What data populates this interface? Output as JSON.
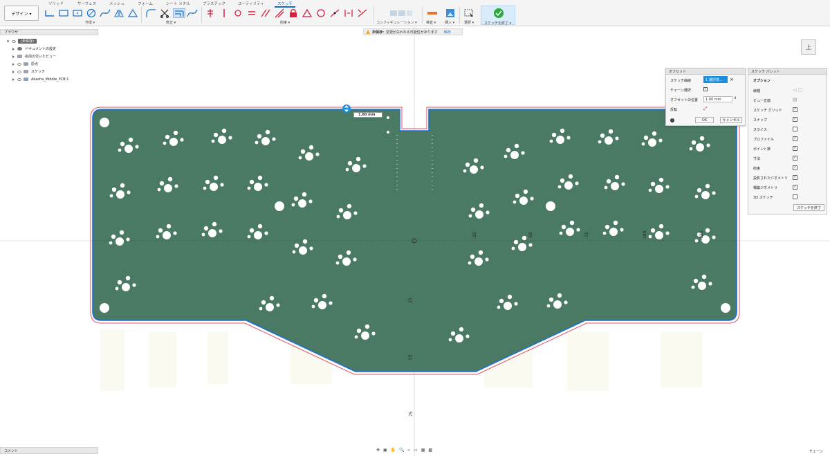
{
  "toolbar": {
    "design_label": "デザイン ▾",
    "tabs": [
      "ソリッド",
      "サーフェス",
      "メッシュ",
      "フォーム",
      "シート メタル",
      "プラスチック",
      "ユーティリティ",
      "スケッチ"
    ],
    "groups": {
      "create": "作成 ▾",
      "modify": "修正 ▾",
      "constraints": "拘束 ▾",
      "configuration": "コンフィギュレーション ▾",
      "inspect": "検査 ▾",
      "insert": "挿入 ▾",
      "select": "選択 ▾",
      "finish": "スケッチを終了 ▾"
    }
  },
  "browser": {
    "title": "ブラウザ",
    "items": [
      {
        "label": "(未保存)"
      },
      {
        "label": "ドキュメントの設定"
      },
      {
        "label": "名前の付いたビュー"
      },
      {
        "label": "原点"
      },
      {
        "label": "スケッチ"
      },
      {
        "label": "Akasha_Middle_PCB:1"
      }
    ]
  },
  "warning": {
    "prefix": "未保存:",
    "message": "変更が失われる可能性があります",
    "save": "保存"
  },
  "offset_dialog": {
    "title": "オフセット",
    "sketch_curve_label": "スケッチ曲線",
    "sketch_curve_value": "1 選択済...",
    "chain_select_label": "チェーン選択",
    "offset_position_label": "オフセットの位置",
    "offset_position_value": "1.00 mm",
    "flip_label": "反転",
    "ok": "OK",
    "cancel": "キャンセル"
  },
  "sketch_palette": {
    "title": "スケッチ パレット",
    "section": "オプション",
    "options": [
      {
        "label": "線種",
        "checked": null
      },
      {
        "label": "ビュー正面",
        "checked": null
      },
      {
        "label": "スケッチ グリッド",
        "checked": true
      },
      {
        "label": "スナップ",
        "checked": true
      },
      {
        "label": "スライス",
        "checked": false
      },
      {
        "label": "プロファイル",
        "checked": true
      },
      {
        "label": "ポイント数",
        "checked": true
      },
      {
        "label": "寸法",
        "checked": true
      },
      {
        "label": "拘束",
        "checked": true
      },
      {
        "label": "投影されたジオメトリ",
        "checked": true
      },
      {
        "label": "構築ジオメトリ",
        "checked": true
      },
      {
        "label": "3D スケッチ",
        "checked": false
      }
    ],
    "finish": "スケッチを終了"
  },
  "canvas": {
    "dimension_value": "1.00 mm",
    "axis_ticks": [
      "25",
      "50",
      "75",
      "-25",
      "-50",
      "-75",
      "-100",
      "-125"
    ],
    "board_color": "#4a7a63",
    "offset_color": "#e0516b"
  },
  "viewcube": {
    "label": "上"
  },
  "comments": {
    "title": "コメント"
  },
  "status": {
    "chain": "チェーン"
  }
}
